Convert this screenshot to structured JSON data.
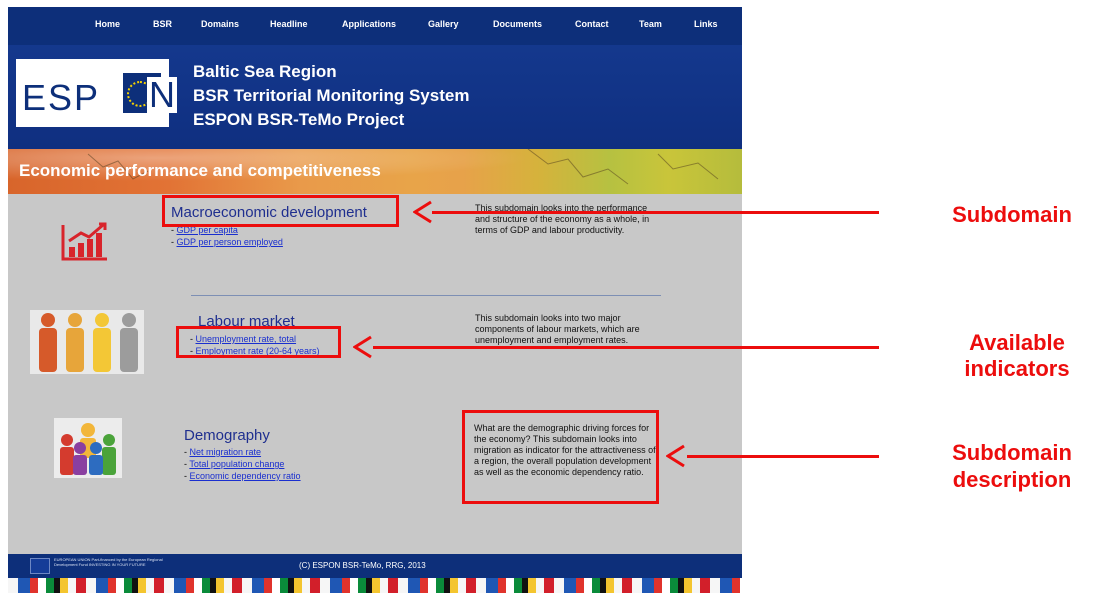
{
  "nav": [
    "Home",
    "BSR",
    "Domains",
    "Headline",
    "Applications",
    "Gallery",
    "Documents",
    "Contact",
    "Team",
    "Links"
  ],
  "logo": {
    "text": "ESP",
    "last": "N"
  },
  "header": {
    "line1": "Baltic Sea Region",
    "line2": "BSR Territorial Monitoring System",
    "line3": "ESPON BSR-TeMo Project"
  },
  "banner_title": "Economic performance and competitiveness",
  "subdomains": [
    {
      "title": "Macroeconomic development",
      "indicators": [
        "GDP per capita",
        "GDP per person employed"
      ],
      "description": "This subdomain looks into the performance and structure of the economy as a whole, in terms of GDP and labour productivity."
    },
    {
      "title": "Labour market",
      "indicators": [
        "Unemployment rate, total",
        "Employment rate (20-64 years)"
      ],
      "description": "This subdomain looks into two major components of labour markets, which are unemployment and employment rates."
    },
    {
      "title": "Demography",
      "indicators": [
        "Net migration rate",
        "Total population change",
        "Economic dependency ratio"
      ],
      "description": "What are the demographic driving forces for the economy? This subdomain looks into migration as indicator for the attractiveness of a region, the overall population development as well as the economic dependency ratio."
    }
  ],
  "annotations": {
    "subdomain": "Subdomain",
    "available_1": "Available",
    "available_2": "indicators",
    "description_1": "Subdomain",
    "description_2": "description"
  },
  "footer": {
    "text": "(C) ESPON BSR-TeMo, RRG, 2013",
    "eu_note": "EUROPEAN UNION Part-financed by the European Regional Development Fund INVESTING IN YOUR FUTURE"
  },
  "colors": {
    "navy": "#0d2f7a",
    "red": "#ec0d0d",
    "link": "#1a2fcf"
  }
}
